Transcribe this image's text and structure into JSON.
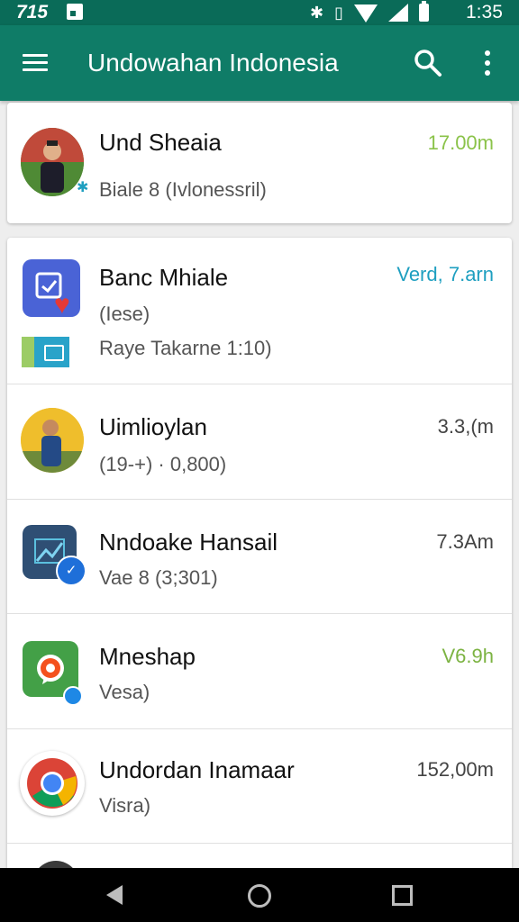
{
  "status_bar": {
    "left_text": "715",
    "clock": "1:35",
    "icons": [
      "notification-icon",
      "nfc-icon",
      "vibrate-icon",
      "wifi-icon",
      "signal-icon",
      "battery-icon"
    ]
  },
  "app_bar": {
    "title": "Undowahan Indonesia",
    "icons": [
      "menu-icon",
      "search-icon",
      "more-vert-icon"
    ]
  },
  "colors": {
    "app_bar": "#0f7c67",
    "status_bar": "#0a6b58",
    "green_time": "#7cb342",
    "teal_time": "#1e9fc0"
  },
  "items": [
    {
      "name": "Und Sheaia",
      "sub": "Biale 8  (Ivlonessril)",
      "time": "17.00m",
      "time_color": "#8bc34a"
    },
    {
      "name": "Banc Mhiale",
      "sub": "(Iese)",
      "sub2": "Raye Takarne 1:10)",
      "time": "Verd, 7.arn",
      "time_color": "#1e9fc0"
    },
    {
      "name": "Uimlioylan",
      "sub": "(19-+) · 0,800)",
      "time": "3.3,(m",
      "time_color": "#444444"
    },
    {
      "name": "Nndoake Hansail",
      "sub": "Vae 8  (3;301)",
      "time": "7.3Am",
      "time_color": "#444444"
    },
    {
      "name": "Mneshap",
      "sub": "Vesa)",
      "time": "V6.9h",
      "time_color": "#7cb342"
    },
    {
      "name": "Undordan Inamaar",
      "sub": "Visra)",
      "time": "152,00m",
      "time_color": "#444444"
    }
  ],
  "nav_bar": {
    "icons": [
      "back-icon",
      "home-icon",
      "recents-icon"
    ]
  }
}
